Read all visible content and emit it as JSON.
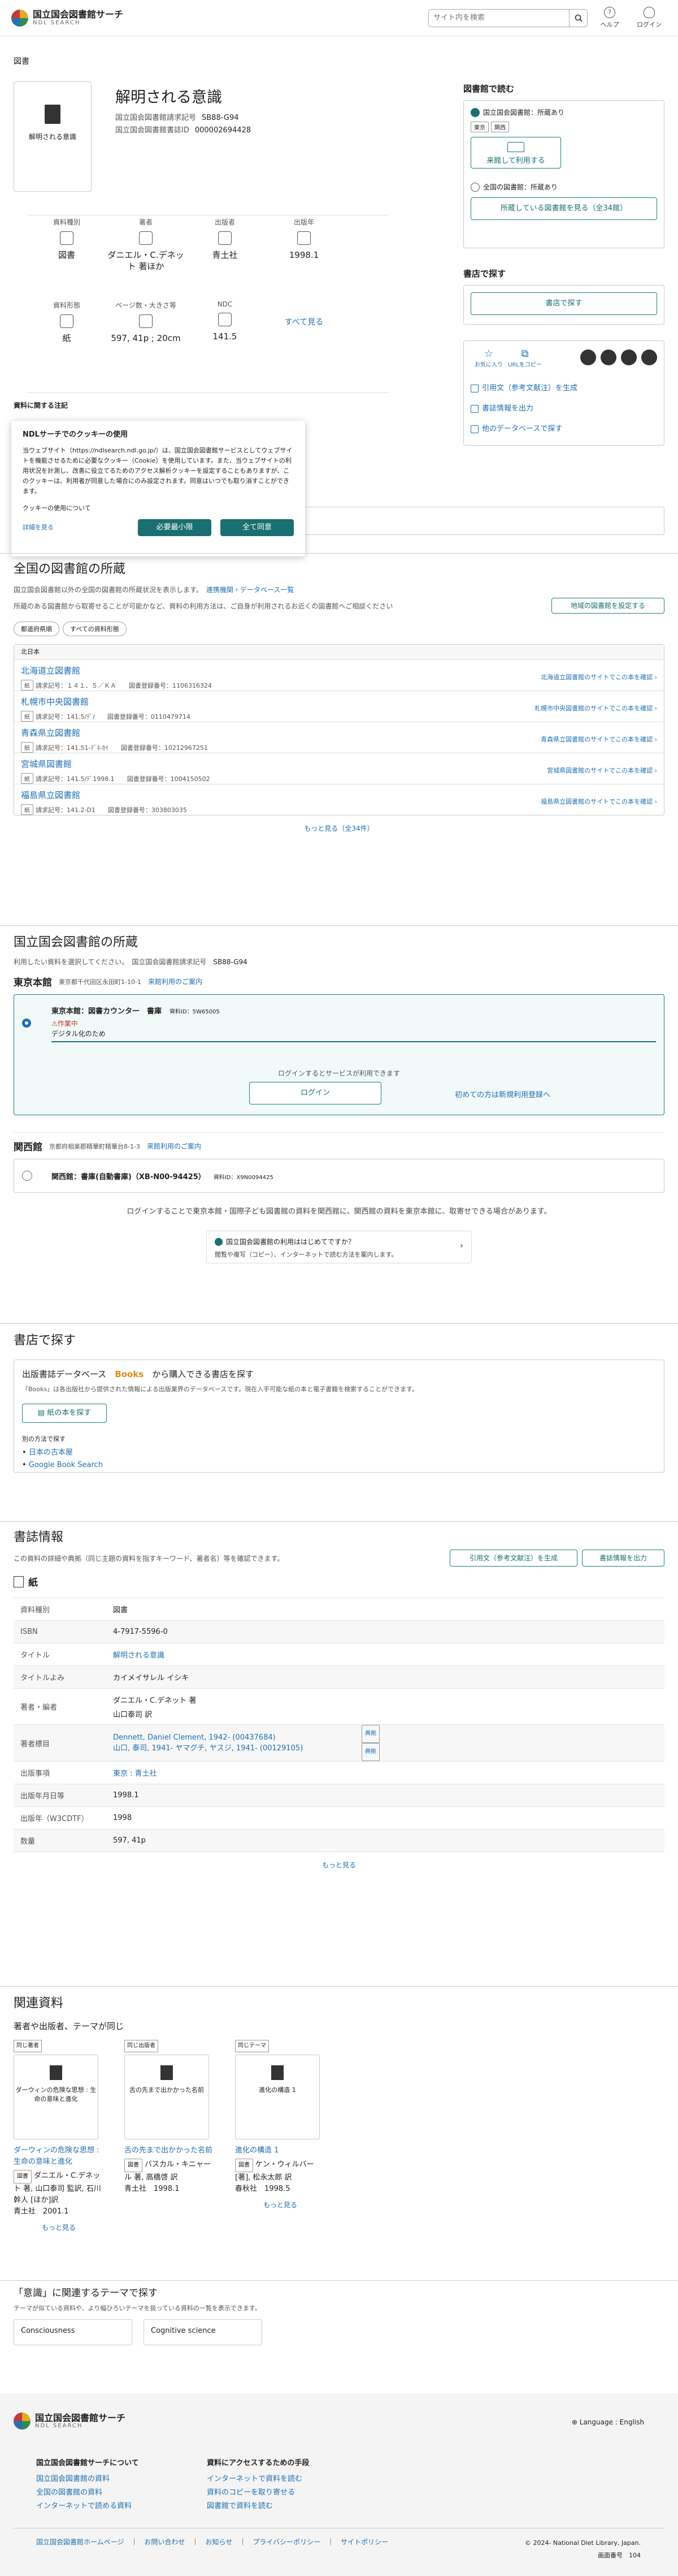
{
  "header": {
    "logo_ja": "国立国会図書館サーチ",
    "logo_en": "NDL SEARCH",
    "search_placeholder": "サイト内を検索",
    "help": "ヘルプ",
    "login": "ログイン",
    "help_icon": "question-icon",
    "login_icon": "user-icon"
  },
  "top": {
    "breadcrumb": "図書",
    "cover_title": "解明される意識",
    "title": "解明される意識",
    "meta": [
      {
        "k": "国立国会図書館請求記号",
        "v": "SB88-G94"
      },
      {
        "k": "国立国会図書館書誌ID",
        "v": "000002694428"
      }
    ],
    "facets1": [
      {
        "k": "資料種別",
        "v": "図書"
      },
      {
        "k": "著者",
        "v": "ダニエル・C.デネット 著ほか"
      },
      {
        "k": "出版者",
        "v": "青土社"
      },
      {
        "k": "出版年",
        "v": "1998.1"
      }
    ],
    "facets2": [
      {
        "k": "資料形態",
        "v": "紙"
      },
      {
        "k": "ページ数・大きさ等",
        "v": "597, 41p ; 20cm"
      },
      {
        "k": "NDC",
        "v": "141.5"
      }
    ],
    "see_all": "すべて見る",
    "notes_label": "資料に関する注記"
  },
  "right": {
    "read_title": "図書館で読む",
    "ndl_label": "国立国会図書館：所蔵あり",
    "tags": [
      "東京",
      "関西"
    ],
    "visit_btn": "来館して利用する",
    "all_label": "全国の図書館：所蔵あり",
    "holdings_btn": "所蔵している図書館を見る（全34館）",
    "shop_title": "書店で探す",
    "shop_btn": "書店で探す",
    "fav": "お気に入り",
    "url_copy": "URLをコピー",
    "cite": "引用文（参考文献注）を生成",
    "export": "書誌情報を出力",
    "other_db": "他のデータベースで探す"
  },
  "cookie": {
    "title": "NDLサーチでのクッキーの使用",
    "body": "当ウェブサイト（https://ndlsearch.ndl.go.jp/）は、国立国会図書館サービスとしてウェブサイトを機能させるために必要なクッキー（Cookie）を使用しています。また、当ウェブサイトの利用状況を計測し、改善に役立てるためのアクセス解析クッキーを設定することもありますが、このクッキーは、利用者が同意した場合にのみ設定されます。同意はいつでも取り消すことができます。",
    "about": "クッキーの使用について",
    "detail": "詳細を見る",
    "necessary": "必要最小限",
    "accept": "全て同意"
  },
  "national": {
    "title": "全国の図書館の所蔵",
    "desc1": "国立国会図書館以外の全国の図書館の所蔵状況を表示します。",
    "link": "連携機関・データベース一覧",
    "desc2": "所蔵のある図書館から取寄せることが可能かなど、資料の利用方法は、ご自身が利用されるお近くの図書館へご相談ください",
    "local_btn": "地域の図書館を設定する",
    "filter1": "都道府県順",
    "filter2": "すべての資料形態",
    "region": "北日本",
    "libs": [
      {
        "n": "北海道立図書館",
        "c": "請求記号：１４１．５／ＫＡ",
        "id": "図書登録番号：1106316324",
        "l": "北海道立図書館のサイトでこの本を確認"
      },
      {
        "n": "札幌市中央図書館",
        "c": "請求記号：141.5/ﾃﾞ/",
        "id": "図書登録番号：0110479714",
        "l": "札幌市中央図書館のサイトでこの本を確認"
      },
      {
        "n": "青森県立図書館",
        "c": "請求記号：141.51-ﾃﾞﾈ-ｶｲ",
        "id": "図書登録番号：10212967251",
        "l": "青森県立図書館のサイトでこの本を確認"
      },
      {
        "n": "宮城県図書館",
        "c": "請求記号：141.5/ﾃﾞ1998.1",
        "id": "図書登録番号：1004150502",
        "l": "宮城県図書館のサイトでこの本を確認"
      },
      {
        "n": "福島県立図書館",
        "c": "請求記号：141.2-D1",
        "id": "図書登録番号：303803035",
        "l": "福島県立図書館のサイトでこの本を確認"
      }
    ],
    "more": "もっと見る（全34件）"
  },
  "ndl": {
    "title": "国立国会図書館の所蔵",
    "desc": "利用したい資料を選択してください。",
    "callno_label": "国立国会図書館請求記号",
    "callno": "SB88-G94",
    "tokyo": {
      "name": "東京本館",
      "addr": "東京都千代田区永田町1-10-1",
      "guide": "来館利用のご案内",
      "loc": "東京本館：図書カウンター　書庫",
      "rid": "資料ID：5W65005",
      "status": "作業中",
      "status_note": "デジタル化のため",
      "login_msg": "ログインするとサービスが利用できます",
      "login": "ログイン",
      "register": "初めての方は新規利用登録へ"
    },
    "kansai": {
      "name": "関西館",
      "addr": "京都府相楽郡精華町精華台8-1-3",
      "guide": "来館利用のご案内",
      "loc": "関西館：書庫(自動書庫)（XB-N00-94425）",
      "rid": "資料ID：X9N0094425"
    },
    "note": "ログインすることで東京本館・国際子ども図書館の資料を関西館に、関西館の資料を東京本館に、取寄せできる場合があります。",
    "first_title": "国立国会図書館の利用ははじめてですか？",
    "first_sub": "閲覧や複写（コピー）、インターネットで読む方法を案内します。"
  },
  "shop": {
    "title": "書店で探す",
    "head": "出版書誌データベース",
    "brand": "Books",
    "head2": "から購入できる書店を探す",
    "desc": "「Books」は各出版社から提供された情報による出版業界のデータベースです。現在入手可能な紙の本と電子書籍を検索することができます。",
    "btn": "紙の本を探す",
    "other": "別の方法で探す",
    "links": [
      "日本の古本屋",
      "Google Book Search"
    ]
  },
  "biblio": {
    "title": "書誌情報",
    "desc": "この資料の詳細や典拠（同じ主題の資料を指すキーワード、著者名）等を確認できます。",
    "cite": "引用文（参考文献注）を生成",
    "export": "書誌情報を出力",
    "form": "紙",
    "rows": [
      {
        "k": "資料種別",
        "v": "図書"
      },
      {
        "k": "ISBN",
        "v": "4-7917-5596-0"
      },
      {
        "k": "タイトル",
        "v": "解明される意識",
        "link": true
      },
      {
        "k": "タイトルよみ",
        "v": "カイメイサレル イシキ"
      },
      {
        "k": "著者・編者",
        "v": "ダニエル・C.デネット 著",
        "v2": "山口泰司 訳"
      },
      {
        "k": "著者標目",
        "v": "Dennett, Daniel Clement, 1942- (00437684)",
        "v2": "山口, 泰司, 1941- ヤマグチ, ヤスジ, 1941- (00129105)",
        "link": true,
        "tag": "典拠"
      },
      {
        "k": "出版事項",
        "v": "東京 : 青土社",
        "link": true
      },
      {
        "k": "出版年月日等",
        "v": "1998.1"
      },
      {
        "k": "出版年（W3CDTF）",
        "v": "1998"
      },
      {
        "k": "数量",
        "v": "597, 41p"
      }
    ],
    "more": "もっと見る"
  },
  "related": {
    "title": "関連資料",
    "sub": "著者や出版者、テーマが同じ",
    "cards": [
      {
        "lb": "同じ著者",
        "cv": "ダーウィンの危険な思想 : 生命の意味と進化",
        "t": "ダーウィンの危険な思想 : 生命の意味と進化",
        "tag": "図書",
        "a": "ダニエル・C.デネット 著, 山口泰司 監訳, 石川幹人 [ほか]訳",
        "p": "青土社　2001.1"
      },
      {
        "lb": "同じ出版者",
        "cv": "舌の先まで出かかった名前",
        "t": "舌の先まで出かかった名前",
        "tag": "図書",
        "a": "バスカル・キニャール 著, 高橋啓 訳",
        "p": "青土社　1998.1"
      },
      {
        "lb": "同じテーマ",
        "cv": "進化の構造 1",
        "t": "進化の構造 1",
        "tag": "図書",
        "a": "ケン・ウィルバー [著], 松永太郎 訳",
        "p": "春秋社　1998.5"
      }
    ],
    "more": "もっと見る"
  },
  "theme": {
    "title": "「意識」に関連するテーマで探す",
    "desc": "テーマが似ている資料や、より幅ひろいテーマを扱っている資料の一覧を表示できます。",
    "items": [
      "Consciousness",
      "Cognitive science"
    ]
  },
  "footer": {
    "lang": "Language : English",
    "col1_title": "国立国会図書館サーチについて",
    "col1": [
      "国立国会図書館の資料",
      "全国の図書館の資料",
      "インターネットで読める資料"
    ],
    "col2_title": "資料にアクセスするための手段",
    "col2": [
      "インターネットで資料を読む",
      "資料のコピーを取り寄せる",
      "図書館で資料を読む"
    ],
    "bottom": [
      "国立国会図書館ホームページ",
      "お問い合わせ",
      "お知らせ",
      "プライバシーポリシー",
      "サイトポリシー"
    ],
    "copy": "© 2024- National Diet Library, Japan.",
    "page_label": "画面番号",
    "page_no": "104"
  }
}
